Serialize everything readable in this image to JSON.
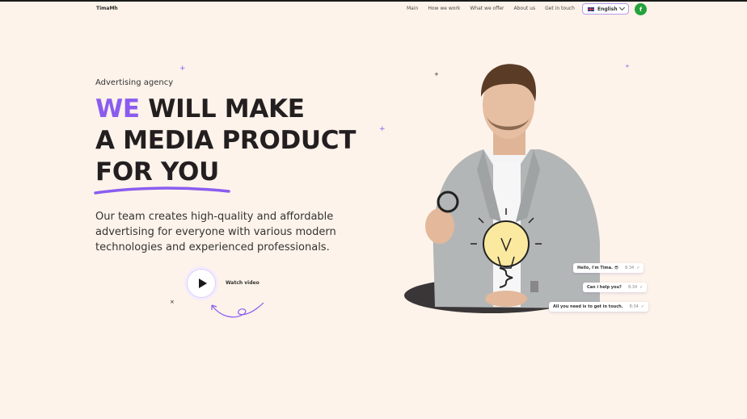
{
  "header": {
    "logo": "TimaMh",
    "nav": [
      "Main",
      "How we work",
      "What we offer",
      "About us",
      "Get in touch"
    ],
    "language": "English",
    "social_icon": "f"
  },
  "hero": {
    "eyebrow": "Advertising agency",
    "headline_accent": "WE",
    "headline_line1_rest": " WILL MAKE",
    "headline_line2": "A MEDIA PRODUCT",
    "headline_line3": "FOR YOU",
    "description": "Our team creates high-quality and affordable advertising for everyone with various modern technologies and experienced professionals.",
    "watch_video": "Watch video"
  },
  "chat": [
    {
      "text": "Hello, I'm Tima. 😎",
      "time": "8:34"
    },
    {
      "text": "Can i help you?",
      "time": "8:34"
    },
    {
      "text": "All you need is to get in touch.",
      "time": "8:34"
    }
  ],
  "colors": {
    "accent": "#8a5cf0",
    "background": "#fdf3ea",
    "facebook": "#23a23b"
  },
  "icons": [
    "flag-uk-icon",
    "chevron-down-icon",
    "facebook-icon",
    "play-icon",
    "check-icon",
    "sparkle-icon"
  ]
}
